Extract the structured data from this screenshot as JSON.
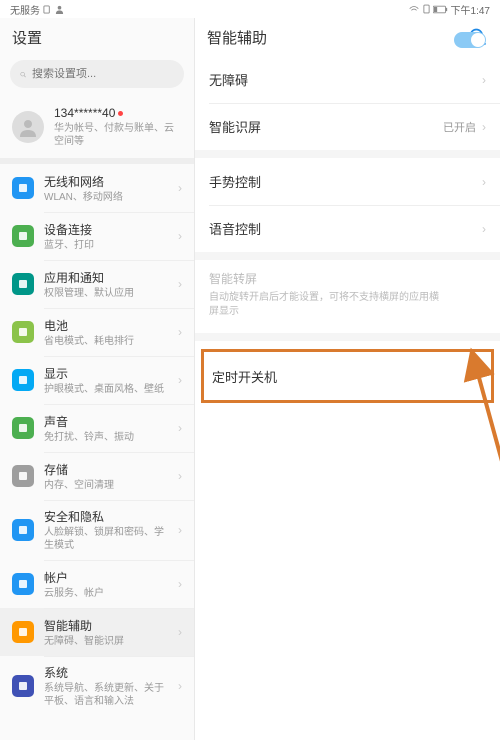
{
  "status": {
    "no_service": "无服务",
    "time": "下午1:47"
  },
  "left_header": "设置",
  "right_header": "智能辅助",
  "search_placeholder": "搜索设置项...",
  "account": {
    "phone": "134******40",
    "sub": "华为帐号、付款与账单、云空间等"
  },
  "settings": [
    {
      "title": "无线和网络",
      "sub": "WLAN、移动网络",
      "color": "#2196f3"
    },
    {
      "title": "设备连接",
      "sub": "蓝牙、打印",
      "color": "#4caf50"
    },
    {
      "title": "应用和通知",
      "sub": "权限管理、默认应用",
      "color": "#009688"
    },
    {
      "title": "电池",
      "sub": "省电模式、耗电排行",
      "color": "#8bc34a"
    },
    {
      "title": "显示",
      "sub": "护眼模式、桌面风格、壁纸",
      "color": "#03a9f4"
    },
    {
      "title": "声音",
      "sub": "免打扰、铃声、振动",
      "color": "#4caf50"
    },
    {
      "title": "存储",
      "sub": "内存、空间清理",
      "color": "#9e9e9e"
    },
    {
      "title": "安全和隐私",
      "sub": "人脸解锁、锁屏和密码、学生模式",
      "color": "#2196f3"
    },
    {
      "title": "帐户",
      "sub": "云服务、帐户",
      "color": "#2196f3"
    },
    {
      "title": "智能辅助",
      "sub": "无障碍、智能识屏",
      "color": "#ff9800",
      "selected": true
    },
    {
      "title": "系统",
      "sub": "系统导航、系统更新、关于平板、语言和输入法",
      "color": "#3f51b5"
    }
  ],
  "right_items": {
    "accessibility": "无障碍",
    "smart_screen": {
      "label": "智能识屏",
      "value": "已开启"
    },
    "gesture": "手势控制",
    "voice": "语音控制",
    "rotate": {
      "title": "智能转屏",
      "sub": "自动旋转开启后才能设置，可将不支持横屏的应用横屏显示"
    },
    "scheduled": "定时开关机"
  }
}
